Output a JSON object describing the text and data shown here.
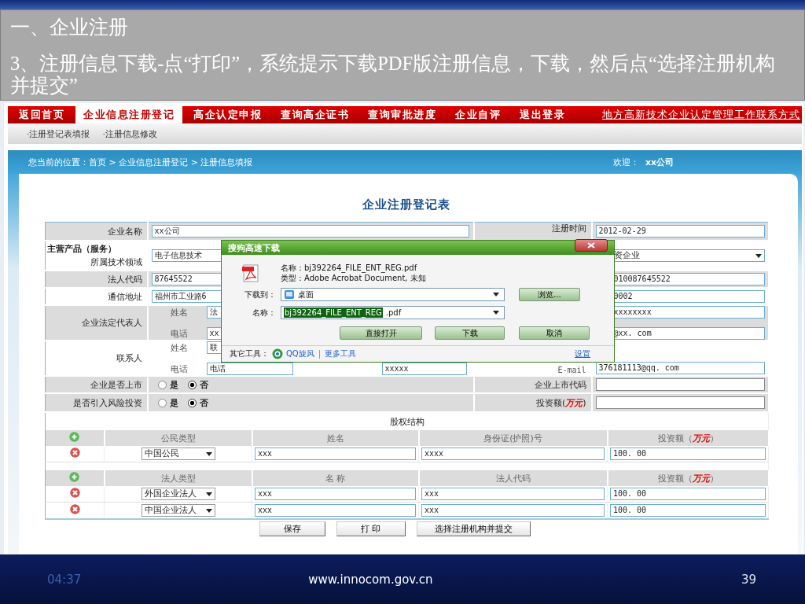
{
  "slide": {
    "heading": "一、企业注册",
    "instruction": "3、注册信息下载-点“打印”，系统提示下载PDF版注册信息，下载，然后点“选择注册机构并提交”"
  },
  "nav": {
    "items": [
      {
        "label": "返回首页",
        "selected": false
      },
      {
        "label": "企业信息注册登记",
        "selected": true
      },
      {
        "label": "高企认定申报",
        "selected": false
      },
      {
        "label": "查询高企证书",
        "selected": false
      },
      {
        "label": "查询审批进度",
        "selected": false
      },
      {
        "label": "企业自评",
        "selected": false
      },
      {
        "label": "退出登录",
        "selected": false
      }
    ],
    "contact_link": "地方高新技术企业认定管理工作联系方式"
  },
  "subnav": [
    "·注册登记表填报",
    "·注册信息修改"
  ],
  "breadcrumb": "您当前的位置：首页 > 企业信息注册登记 > 注册信息填报",
  "welcome": {
    "label": "欢迎：",
    "user": "xx公司"
  },
  "form": {
    "title": "企业注册登记表",
    "company_name": {
      "label": "企业名称",
      "value": "xx公司"
    },
    "registration_date": {
      "label": "注册时间",
      "value": "2012-02-29"
    },
    "tech_field": {
      "label_line_1": "主营产品（服务）",
      "label_line_2": "所属技术领域",
      "value": "电子信息技术"
    },
    "enterprise_type": {
      "value": "资企业"
    },
    "legal_code": {
      "label": "法人代码",
      "value": "87645522"
    },
    "org_code": {
      "value": "010087645522"
    },
    "address": {
      "label": "通信地址",
      "value": "福州市工业路6"
    },
    "postcode": {
      "value": "0002"
    },
    "legal_rep": {
      "label": "企业法定代表人",
      "name_label": "姓名",
      "name_value": "法",
      "phone_label": "电话",
      "phone_value": "xx",
      "right_1": "xxxxxxxx",
      "right_2": "@xx. com"
    },
    "contact": {
      "label": "联系人",
      "name_label": "姓名",
      "name_value": "联",
      "phone_label": "电话",
      "phone_value": "电话",
      "fax_value": "xxxxx",
      "email_label": "E-mail",
      "email_value": "376181113@qq. com"
    },
    "listed": {
      "label": "企业是否上市",
      "options": [
        {
          "label": "是",
          "selected": false
        },
        {
          "label": "否",
          "selected": true
        }
      ],
      "code_label": "企业上市代码"
    },
    "venture": {
      "label": "是否引入风险投资",
      "options": [
        {
          "label": "是",
          "selected": false
        },
        {
          "label": "否",
          "selected": true
        }
      ],
      "amount_label": "投资额(**万元**)"
    },
    "equity": {
      "title": "股权结构",
      "tables": [
        {
          "columns": [
            "公民类型",
            "姓名",
            "身份证(护照)号",
            "投资额（**万元**）"
          ],
          "rows": [
            {
              "type": "中国公民",
              "name": "xxx",
              "id": "xxxx",
              "amount": "100. 00"
            }
          ]
        },
        {
          "columns": [
            "法人类型",
            "名 称",
            "法人代码",
            "投资额（**万元**）"
          ],
          "rows": [
            {
              "type": "外国企业法人",
              "name": "xxx",
              "id": "xxx",
              "amount": "100. 00"
            },
            {
              "type": "中国企业法人",
              "name": "xxx",
              "id": "xxx",
              "amount": "100. 00"
            }
          ]
        }
      ]
    },
    "buttons": [
      "保存",
      "打 印",
      "选择注册机构并提交"
    ]
  },
  "dialog": {
    "title": "搜狗高速下载",
    "file_name": "名称：bj392264_FILE_ENT_REG.pdf",
    "file_type": "类型：Adobe Acrobat Document, 未知",
    "save_to_label": "下载到：",
    "save_to": "桌面",
    "browse": "浏览...",
    "name_label": "名称：",
    "name_selected": "bj392264_FILE_ENT_REG",
    "name_rest": ".pdf",
    "buttons": [
      "直接打开",
      "下载",
      "取消"
    ],
    "tools_label": "其它工具：",
    "tools": [
      "QQ旋风",
      "更多工具"
    ],
    "settings": "设置"
  },
  "footer": {
    "time": "04:37",
    "url": "www.innocom.gov.cn",
    "page": "39"
  }
}
